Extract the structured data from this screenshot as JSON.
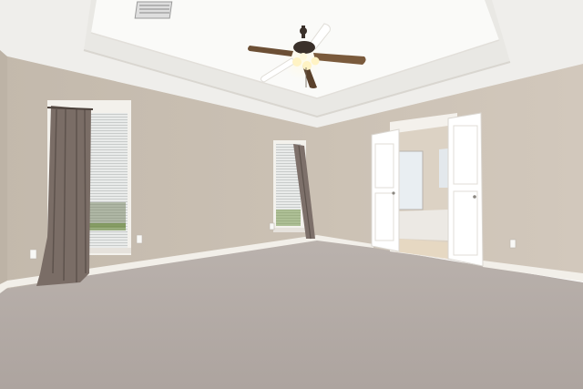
{
  "scene": {
    "kind": "empty-bedroom-photo",
    "palette": {
      "wall": "#c9bfb2",
      "wall_side": "#cfc5b8",
      "ceiling": "#f4f3f0",
      "tray": "#fbfbfa",
      "carpet": "#b5aca6",
      "trim": "#f4f1ec",
      "curtain": "#7d7069",
      "door": "#ffffff",
      "fan_blade": "#7a5a3c",
      "fan_motor": "#3a302a",
      "light": "#fff6d8"
    },
    "elements": [
      "tray-ceiling",
      "ceiling-fan",
      "left-window",
      "center-window",
      "curtains",
      "double-door",
      "ensuite-bathroom",
      "carpet-floor",
      "baseboards",
      "ceiling-vent",
      "wall-outlets"
    ]
  }
}
